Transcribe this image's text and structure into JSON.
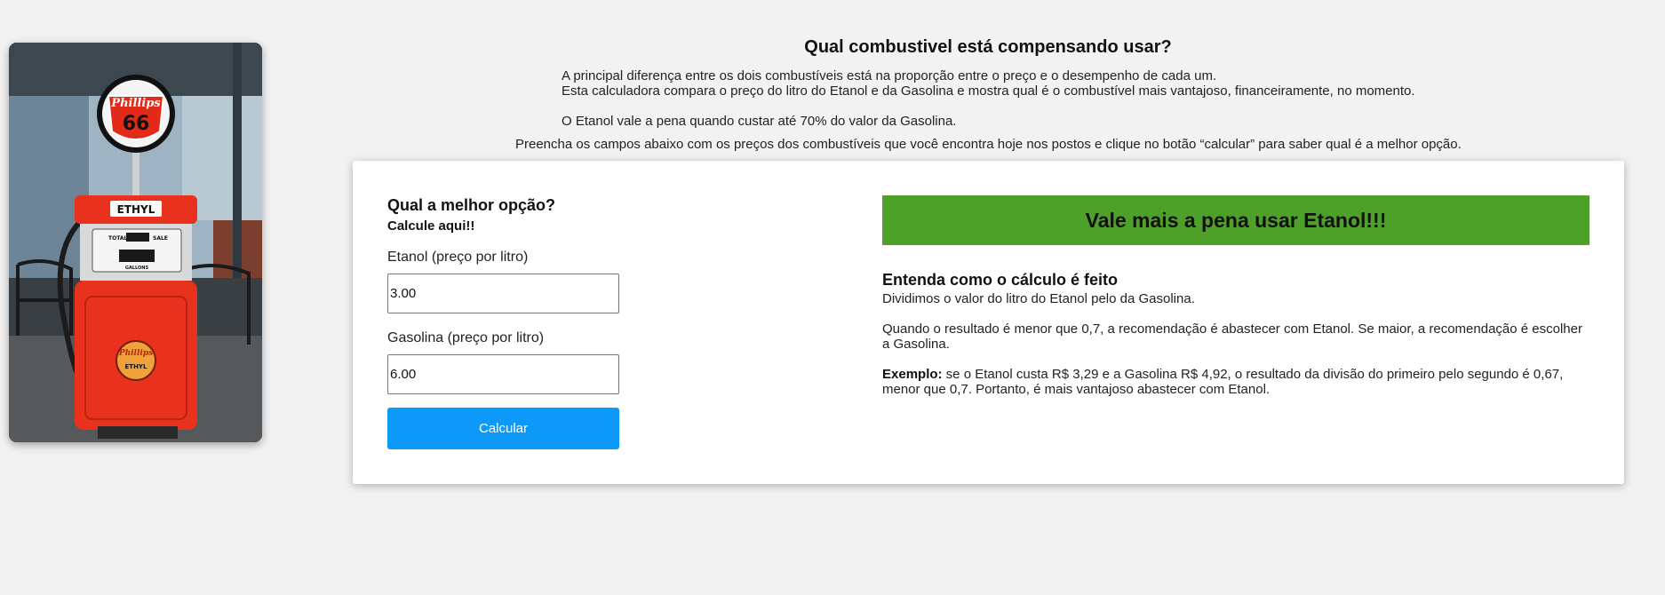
{
  "intro": {
    "title": "Qual combustivel está compensando usar?",
    "line1": "A principal diferença entre os dois combustíveis está na proporção entre o preço e o desempenho de cada um.",
    "line2": "Esta calculadora compara o preço do litro do Etanol e da Gasolina e mostra qual é o combustível mais vantajoso, financeiramente, no momento.",
    "line3": "O Etanol vale a pena quando custar até 70% do valor da Gasolina.",
    "instructions": "Preencha os campos abaixo com os preços dos combustíveis que você encontra hoje nos postos e clique no botão “calcular” para saber qual é a melhor opção."
  },
  "photo": {
    "alt": "Bomba de combustível Phillips 66",
    "sign_brand": "Phillips",
    "sign_number": "66",
    "pump_label": "ETHYL",
    "meter_total": "TOTAL",
    "meter_sale": "SALE",
    "meter_gallons": "GALLONS",
    "badge_brand": "Phillips",
    "badge_sub": "ETHYL"
  },
  "form": {
    "title": "Qual a melhor opção?",
    "subtitle": "Calcule aqui!!",
    "ethanol_label": "Etanol (preço por litro)",
    "ethanol_value": "3.00",
    "gasoline_label": "Gasolina (preço por litro)",
    "gasoline_value": "6.00",
    "button_label": "Calcular"
  },
  "result": {
    "banner": "Vale mais a pena usar Etanol!!!",
    "banner_color": "#4fa02a"
  },
  "explanation": {
    "title": "Entenda como o cálculo é feito",
    "p1": "Dividimos o valor do litro do Etanol pelo da Gasolina.",
    "p2": "Quando o resultado é menor que 0,7, a recomendação é abastecer com Etanol. Se maior, a recomendação é escolher a Gasolina.",
    "example_label": "Exemplo:",
    "example_text": " se o Etanol custa R$ 3,29 e a Gasolina R$ 4,92, o resultado da divisão do primeiro pelo segundo é 0,67, menor que 0,7. Portanto, é mais vantajoso abastecer com Etanol."
  },
  "colors": {
    "background": "#f2f2f2",
    "button": "#0d99f8",
    "banner": "#4fa02a",
    "pump_red": "#e8321d"
  }
}
